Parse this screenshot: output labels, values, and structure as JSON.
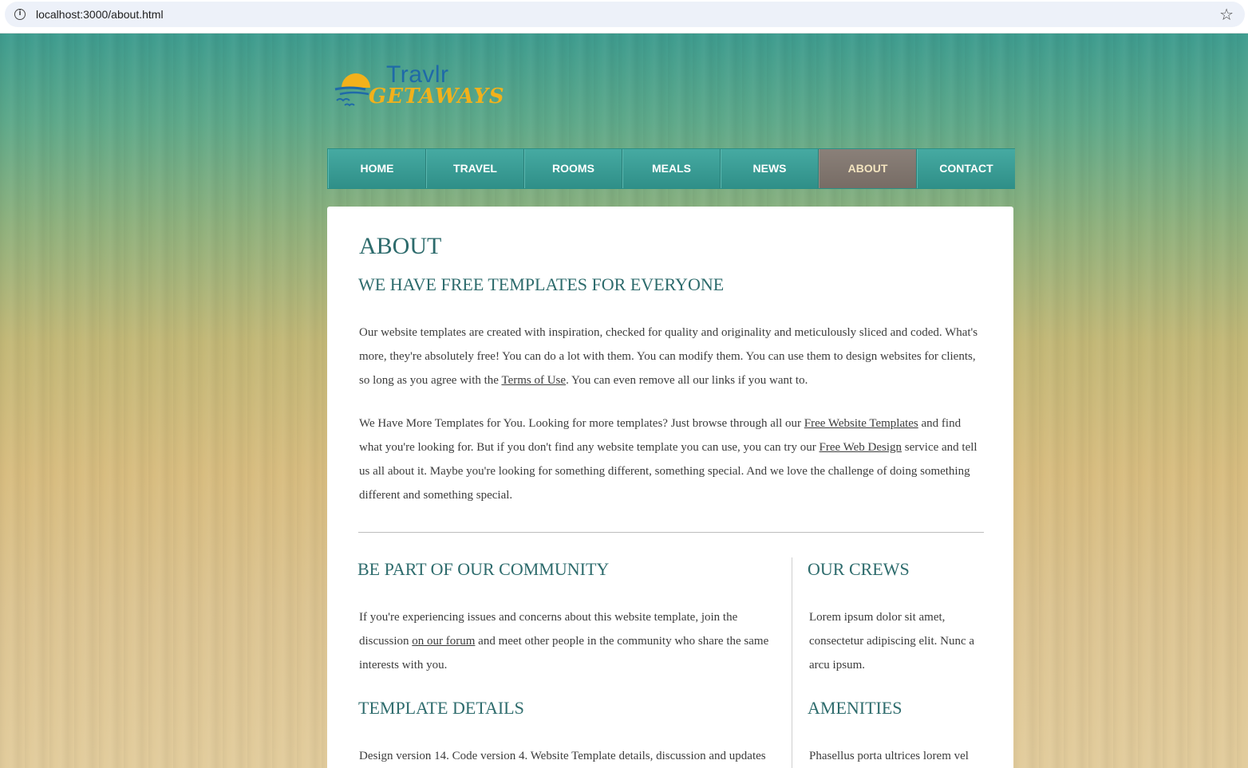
{
  "browser": {
    "url": "localhost:3000/about.html",
    "info_icon": "i",
    "star_icon": "☆"
  },
  "logo": {
    "line1": "Travlr",
    "line2": "GETAWAYS"
  },
  "nav": {
    "items": [
      "HOME",
      "TRAVEL",
      "ROOMS",
      "MEALS",
      "NEWS",
      "ABOUT",
      "CONTACT"
    ],
    "active": "ABOUT"
  },
  "main": {
    "title": "ABOUT",
    "subtitle": "WE HAVE FREE TEMPLATES FOR EVERYONE",
    "p1_before": "Our website templates are created with inspiration, checked for quality and originality and meticulously sliced and coded. What's more, they're absolutely free! You can do a lot with them. You can modify them. You can use them to design websites for clients, so long as you agree with the ",
    "p1_link": "Terms of Use",
    "p1_after": ". You can even remove all our links if you want to.",
    "p2_before": "We Have More Templates for You. Looking for more templates? Just browse through all our ",
    "p2_link1": "Free Website Templates",
    "p2_mid": " and find what you're looking for. But if you don't find any website template you can use, you can try our ",
    "p2_link2": "Free Web Design",
    "p2_after": " service and tell us all about it. Maybe you're looking for something different, something special. And we love the challenge of doing something different and something special."
  },
  "community": {
    "title": "BE PART OF OUR COMMUNITY",
    "text_before": "If you're experiencing issues and concerns about this website template, join the discussion ",
    "link": "on our forum",
    "text_after": " and meet other people in the community who share the same interests with you."
  },
  "crews": {
    "title": "OUR CREWS",
    "text": "Lorem ipsum dolor sit amet, consectetur adipiscing elit. Nunc a arcu ipsum."
  },
  "details": {
    "title": "TEMPLATE DETAILS",
    "text": "Design version 14. Code version 4. Website Template details, discussion and updates"
  },
  "amenities": {
    "title": "AMENITIES",
    "text": "Phasellus porta ultrices lorem vel"
  },
  "colors": {
    "heading": "#2d6b6c",
    "nav_teal": "#3a9c95",
    "nav_active": "#7f746d",
    "logo_blue": "#1f6aa8",
    "logo_gold": "#f2b11b"
  }
}
